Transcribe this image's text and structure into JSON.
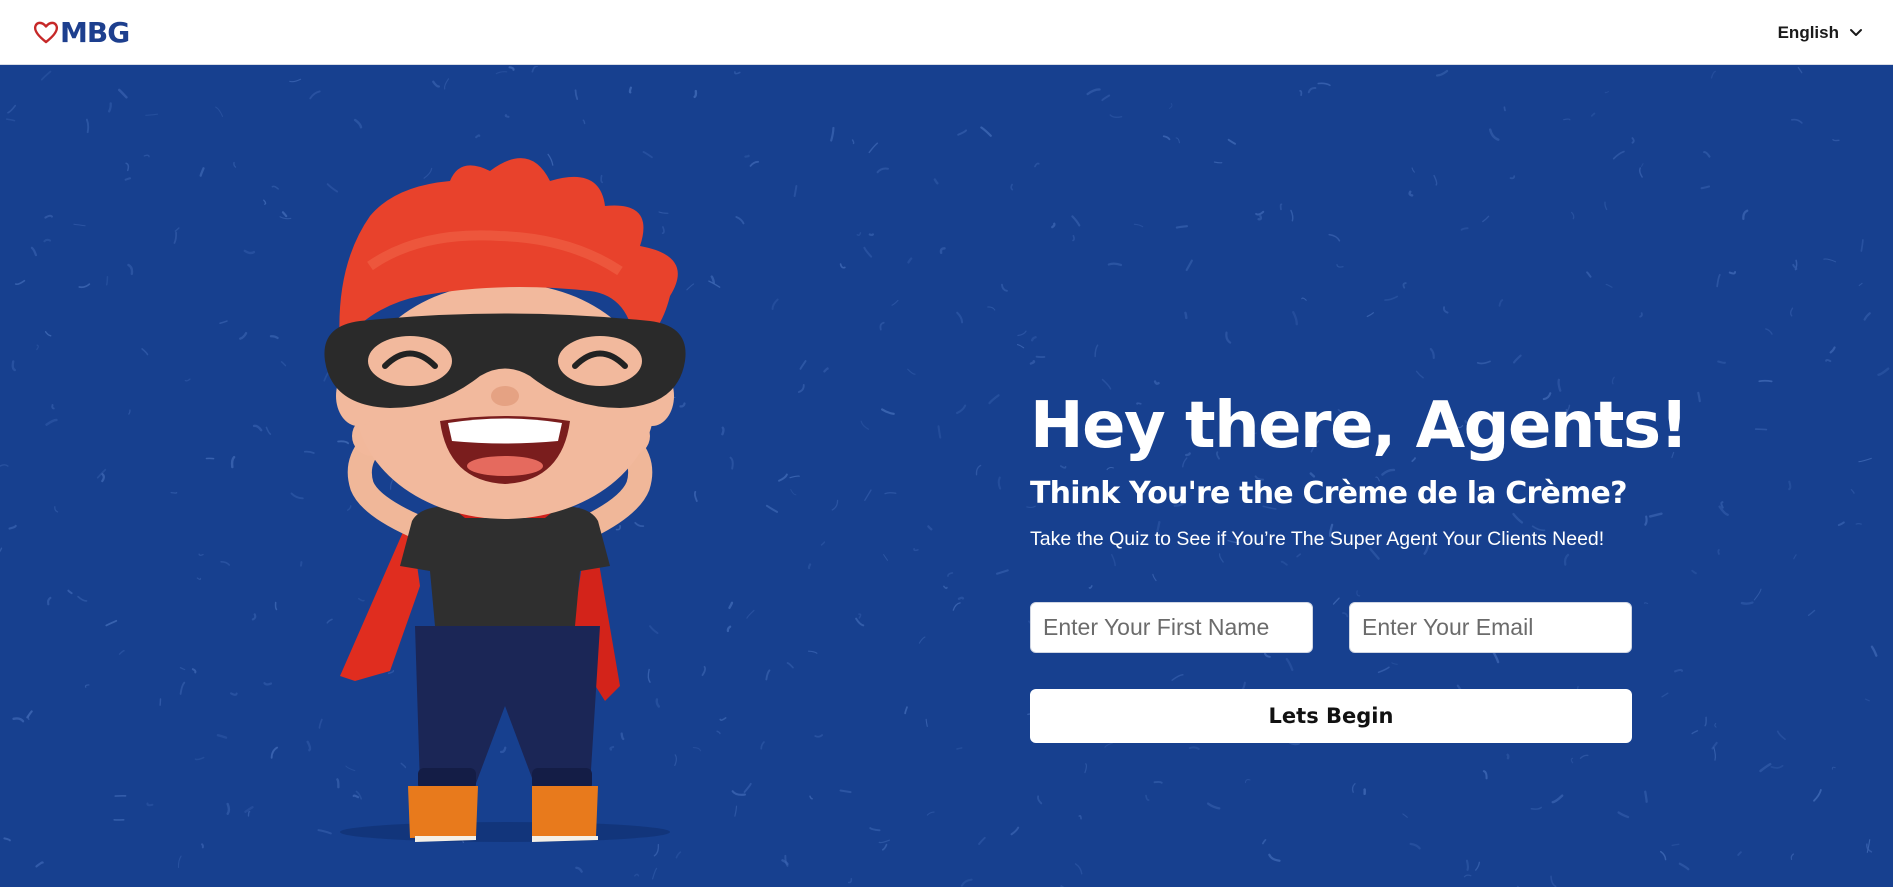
{
  "header": {
    "logo_text": "MBG",
    "language_label": "English"
  },
  "hero": {
    "title": "Hey there, Agents!",
    "subtitle": "Think You're the Crème de la Crème?",
    "tagline": "Take the Quiz to See if You’re The Super Agent Your Clients Need!",
    "first_name_placeholder": "Enter Your First Name",
    "email_placeholder": "Enter Your Email",
    "cta_label": "Lets Begin"
  },
  "colors": {
    "brand_blue": "#1d3f8e",
    "hero_background": "#17408f",
    "heart_red": "#c62828"
  },
  "icons": [
    "heart-logo-icon",
    "chevron-down-icon"
  ]
}
